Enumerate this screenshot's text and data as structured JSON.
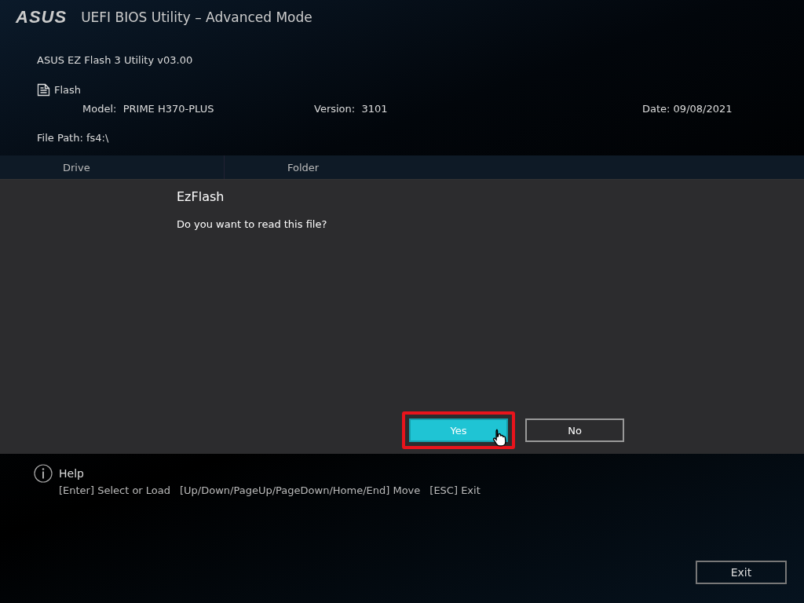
{
  "header": {
    "logo": "ASUS",
    "title": "UEFI BIOS Utility – Advanced Mode"
  },
  "utility": {
    "name": "ASUS EZ Flash 3 Utility v03.00",
    "section": "Flash",
    "model_label": "Model:",
    "model": "PRIME H370-PLUS",
    "version_label": "Version:",
    "version": "3101",
    "date": "Date: 09/08/2021",
    "file_path": "File Path: fs4:\\"
  },
  "table": {
    "columns": [
      "Drive",
      "Folder"
    ]
  },
  "dialog": {
    "title": "EzFlash",
    "message": "Do you want to read this file?",
    "buttons": [
      {
        "label": "Yes",
        "selected": true,
        "highlighted": true
      },
      {
        "label": "No",
        "selected": false,
        "highlighted": false
      }
    ]
  },
  "help": {
    "title": "Help",
    "shortcuts": [
      "[Enter] Select or Load",
      "[Up/Down/PageUp/PageDown/Home/End] Move",
      "[ESC] Exit"
    ]
  },
  "footer": {
    "exit_button": "Exit"
  }
}
